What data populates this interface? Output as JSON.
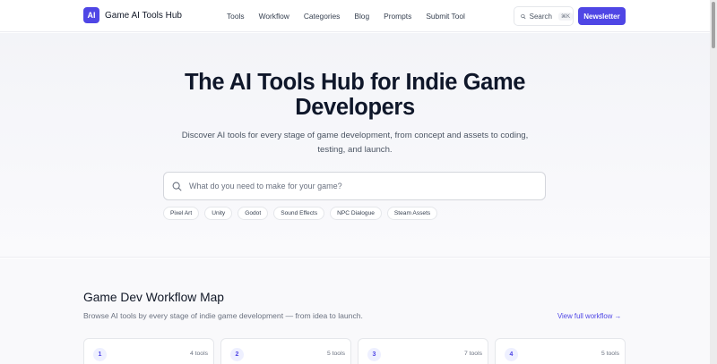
{
  "header": {
    "logo_badge": "AI",
    "logo_text": "Game AI Tools Hub",
    "nav": [
      "Tools",
      "Workflow",
      "Categories",
      "Blog",
      "Prompts",
      "Submit Tool"
    ],
    "search_label": "Search",
    "search_shortcut": "⌘K",
    "newsletter_label": "Newsletter"
  },
  "hero": {
    "title_line1": "The AI Tools Hub for Indie Game",
    "title_line2": "Developers",
    "subtitle_line1": "Discover AI tools for every stage of game development, from concept and assets to coding,",
    "subtitle_line2": "testing, and launch.",
    "search_placeholder": "What do you need to make for your game?",
    "chips": [
      "Pixel Art",
      "Unity",
      "Godot",
      "Sound Effects",
      "NPC Dialogue",
      "Steam Assets"
    ]
  },
  "workflow": {
    "title": "Game Dev Workflow Map",
    "subtitle": "Browse AI tools by every stage of indie game development — from idea to launch.",
    "view_link": "View full workflow →",
    "cards": [
      {
        "number": "1",
        "count": "4 tools"
      },
      {
        "number": "2",
        "count": "5 tools"
      },
      {
        "number": "3",
        "count": "7 tools"
      },
      {
        "number": "4",
        "count": "5 tools"
      }
    ]
  },
  "colors": {
    "accent": "#4f46e5",
    "hero_bg": "#f3f4f8",
    "text": "#111827"
  }
}
